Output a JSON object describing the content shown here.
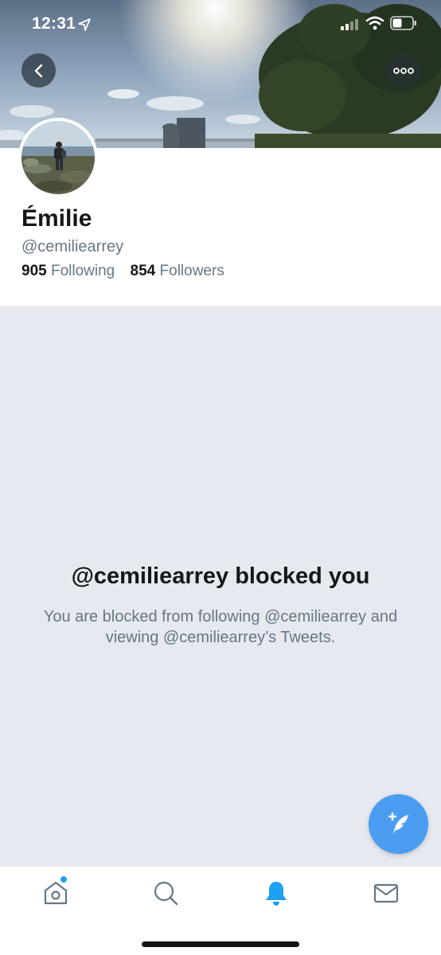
{
  "status_bar": {
    "time": "12:31"
  },
  "header": {
    "back_icon": "chevron-left-icon",
    "more_icon": "ellipsis-icon"
  },
  "profile": {
    "name": "Émilie",
    "handle": "@cemiliearrey",
    "following_count": "905",
    "following_label": "Following",
    "followers_count": "854",
    "followers_label": "Followers"
  },
  "blocked": {
    "title": "@cemiliearrey blocked you",
    "message": "You are blocked from following @cemiliearrey and viewing @cemiliearrey’s Tweets."
  },
  "fab": {
    "icon": "compose-tweet-icon"
  },
  "tabbar": {
    "items": [
      {
        "name": "home",
        "icon": "home-icon",
        "active": false,
        "has_dot": true
      },
      {
        "name": "search",
        "icon": "search-icon",
        "active": false
      },
      {
        "name": "notifications",
        "icon": "bell-icon",
        "active": true
      },
      {
        "name": "messages",
        "icon": "mail-icon",
        "active": false
      }
    ]
  },
  "colors": {
    "accent": "#1da1f2",
    "fab": "#4a9df0",
    "muted_text": "#657786",
    "primary_text": "#14171a",
    "blocked_bg": "#e6e9ef"
  }
}
